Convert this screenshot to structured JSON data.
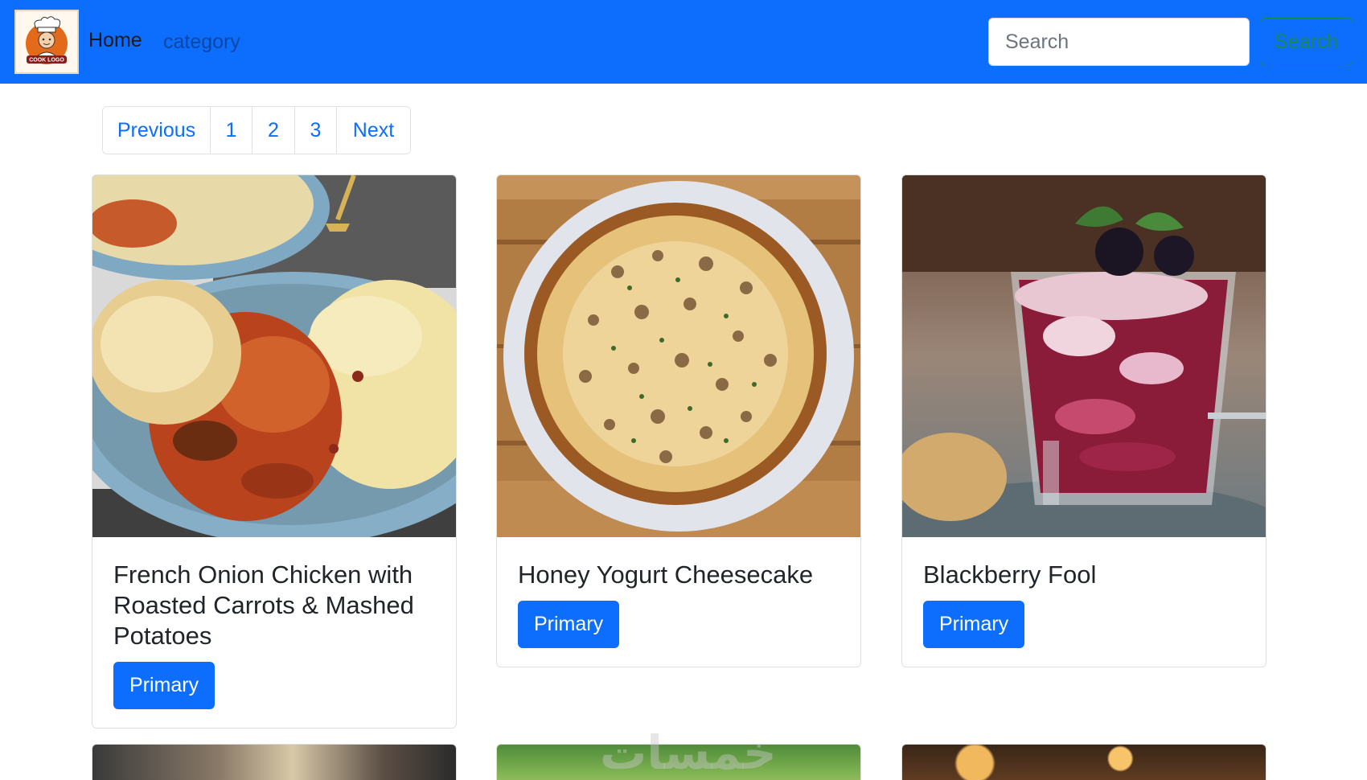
{
  "navbar": {
    "logo_text": "COOK LOGO",
    "home_label": "Home",
    "category_label": "category",
    "search_placeholder": "Search",
    "search_button_label": "Search"
  },
  "pagination": {
    "previous_label": "Previous",
    "pages": [
      "1",
      "2",
      "3"
    ],
    "next_label": "Next"
  },
  "cards": [
    {
      "title": "French Onion Chicken with Roasted Carrots & Mashed Potatoes",
      "button_label": "Primary"
    },
    {
      "title": "Honey Yogurt Cheesecake",
      "button_label": "Primary"
    },
    {
      "title": "Blackberry Fool",
      "button_label": "Primary"
    }
  ],
  "watermark_text": "خمسات",
  "colors": {
    "navbar_bg": "#0d6efd",
    "primary": "#0d6efd",
    "success": "#198754"
  }
}
